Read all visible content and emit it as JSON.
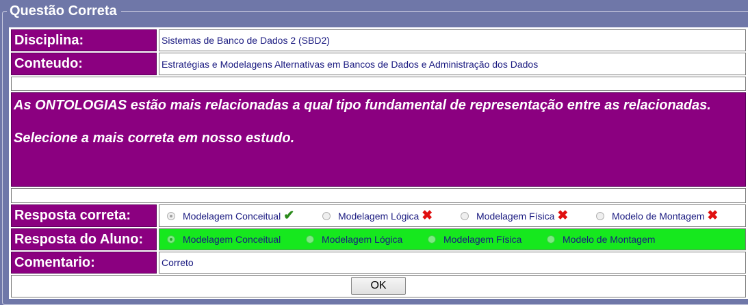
{
  "title": "Questão Correta",
  "disciplina": {
    "label": "Disciplina:",
    "value": "Sistemas de Banco de Dados 2 (SBD2)"
  },
  "conteudo": {
    "label": "Conteudo:",
    "value": "Estratégias e Modelagens Alternativas em Bancos de Dados e Administração dos Dados"
  },
  "question": {
    "line1": "As ONTOLOGIAS estão mais relacionadas a qual tipo fundamental de representação entre as relacionadas.",
    "line2": "Selecione a mais correta em nosso estudo."
  },
  "resposta_correta": {
    "label": "Resposta correta:",
    "options": [
      "Modelagem Conceitual",
      "Modelagem Lógica",
      "Modelagem Física",
      "Modelo de Montagem"
    ],
    "marks": [
      "✔",
      "✖",
      "✖",
      "✖"
    ]
  },
  "resposta_aluno": {
    "label": "Resposta do Aluno:",
    "options": [
      "Modelagem Conceitual",
      "Modelagem Lógica",
      "Modelagem Física",
      "Modelo de Montagem"
    ]
  },
  "comentario": {
    "label": "Comentario:",
    "value": "Correto"
  },
  "ok_button": "OK",
  "colors": {
    "label_bg": "#8b0080",
    "page_bg": "#6f77a8",
    "student_bg": "#16e81e"
  }
}
